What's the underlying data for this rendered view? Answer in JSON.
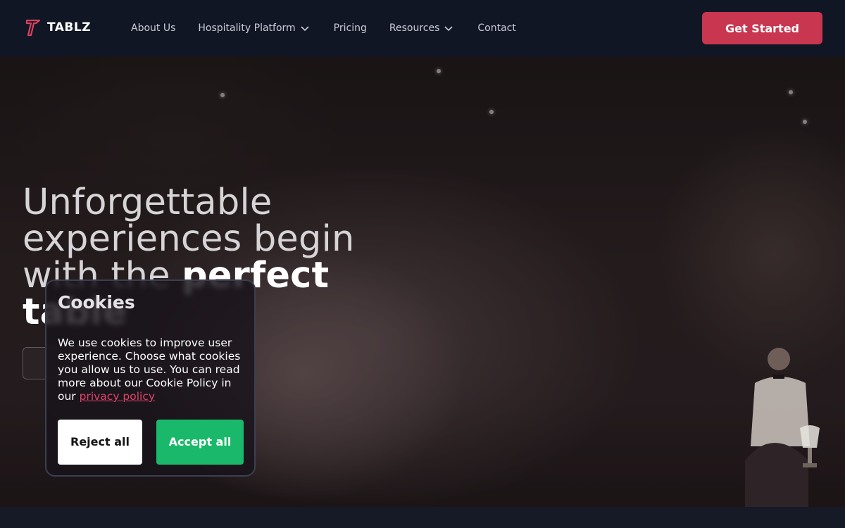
{
  "brand": {
    "name": "TABLZ",
    "logo_icon": "tablz-logo-icon",
    "accent_color": "#c9364f"
  },
  "nav": {
    "items": [
      {
        "label": "About Us",
        "has_dropdown": false
      },
      {
        "label": "Hospitality Platform",
        "has_dropdown": true
      },
      {
        "label": "Pricing",
        "has_dropdown": false
      },
      {
        "label": "Resources",
        "has_dropdown": true
      },
      {
        "label": "Contact",
        "has_dropdown": false
      }
    ],
    "cta_label": "Get Started"
  },
  "hero": {
    "headline_light": "Unforgettable experiences begin with the ",
    "headline_bold": "perfect table"
  },
  "cookie_banner": {
    "title": "Cookies",
    "body": "We use cookies to improve user experience. Choose what cookies you allow us to use. You can read more about our Cookie Policy in our ",
    "link_text": "privacy policy",
    "reject_label": "Reject all",
    "accept_label": "Accept all",
    "accept_color": "#1ab86a"
  }
}
